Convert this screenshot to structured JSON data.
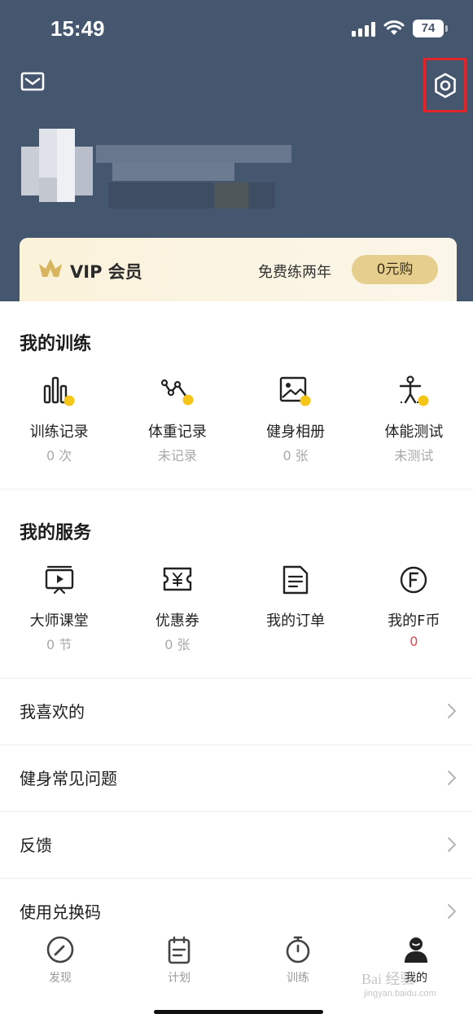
{
  "status_bar": {
    "time": "15:49",
    "battery": "74"
  },
  "vip": {
    "label": "VIP 会员",
    "desc": "免费练两年",
    "buy_label": "0元购"
  },
  "training": {
    "title": "我的训练",
    "items": [
      {
        "label": "训练记录",
        "sub": "0 次",
        "icon": "bar-chart-icon"
      },
      {
        "label": "体重记录",
        "sub": "未记录",
        "icon": "weight-trend-icon"
      },
      {
        "label": "健身相册",
        "sub": "0 张",
        "icon": "photo-album-icon"
      },
      {
        "label": "体能测试",
        "sub": "未测试",
        "icon": "fitness-test-icon"
      }
    ]
  },
  "services": {
    "title": "我的服务",
    "items": [
      {
        "label": "大师课堂",
        "sub": "0 节",
        "icon": "video-class-icon"
      },
      {
        "label": "优惠券",
        "sub": "0 张",
        "icon": "coupon-icon"
      },
      {
        "label": "我的订单",
        "sub": "",
        "icon": "order-icon"
      },
      {
        "label": "我的F币",
        "sub": "0",
        "icon": "f-coin-icon"
      }
    ]
  },
  "menu": [
    {
      "label": "我喜欢的"
    },
    {
      "label": "健身常见问题"
    },
    {
      "label": "反馈"
    },
    {
      "label": "使用兑换码"
    }
  ],
  "tabbar": [
    {
      "label": "发现",
      "icon": "discover-icon",
      "active": false
    },
    {
      "label": "计划",
      "icon": "plan-icon",
      "active": false
    },
    {
      "label": "训练",
      "icon": "stopwatch-icon",
      "active": false
    },
    {
      "label": "我的",
      "icon": "profile-icon",
      "active": true
    }
  ],
  "watermark": {
    "text": "Bai 经验",
    "url": "jingyan.baidu.com"
  },
  "colors": {
    "header_bg": "#45566f",
    "accent_yellow": "#f5c518",
    "highlight_box": "#e0262b",
    "vip_button": "#e6cf8e",
    "coin_value": "#e5484d"
  }
}
